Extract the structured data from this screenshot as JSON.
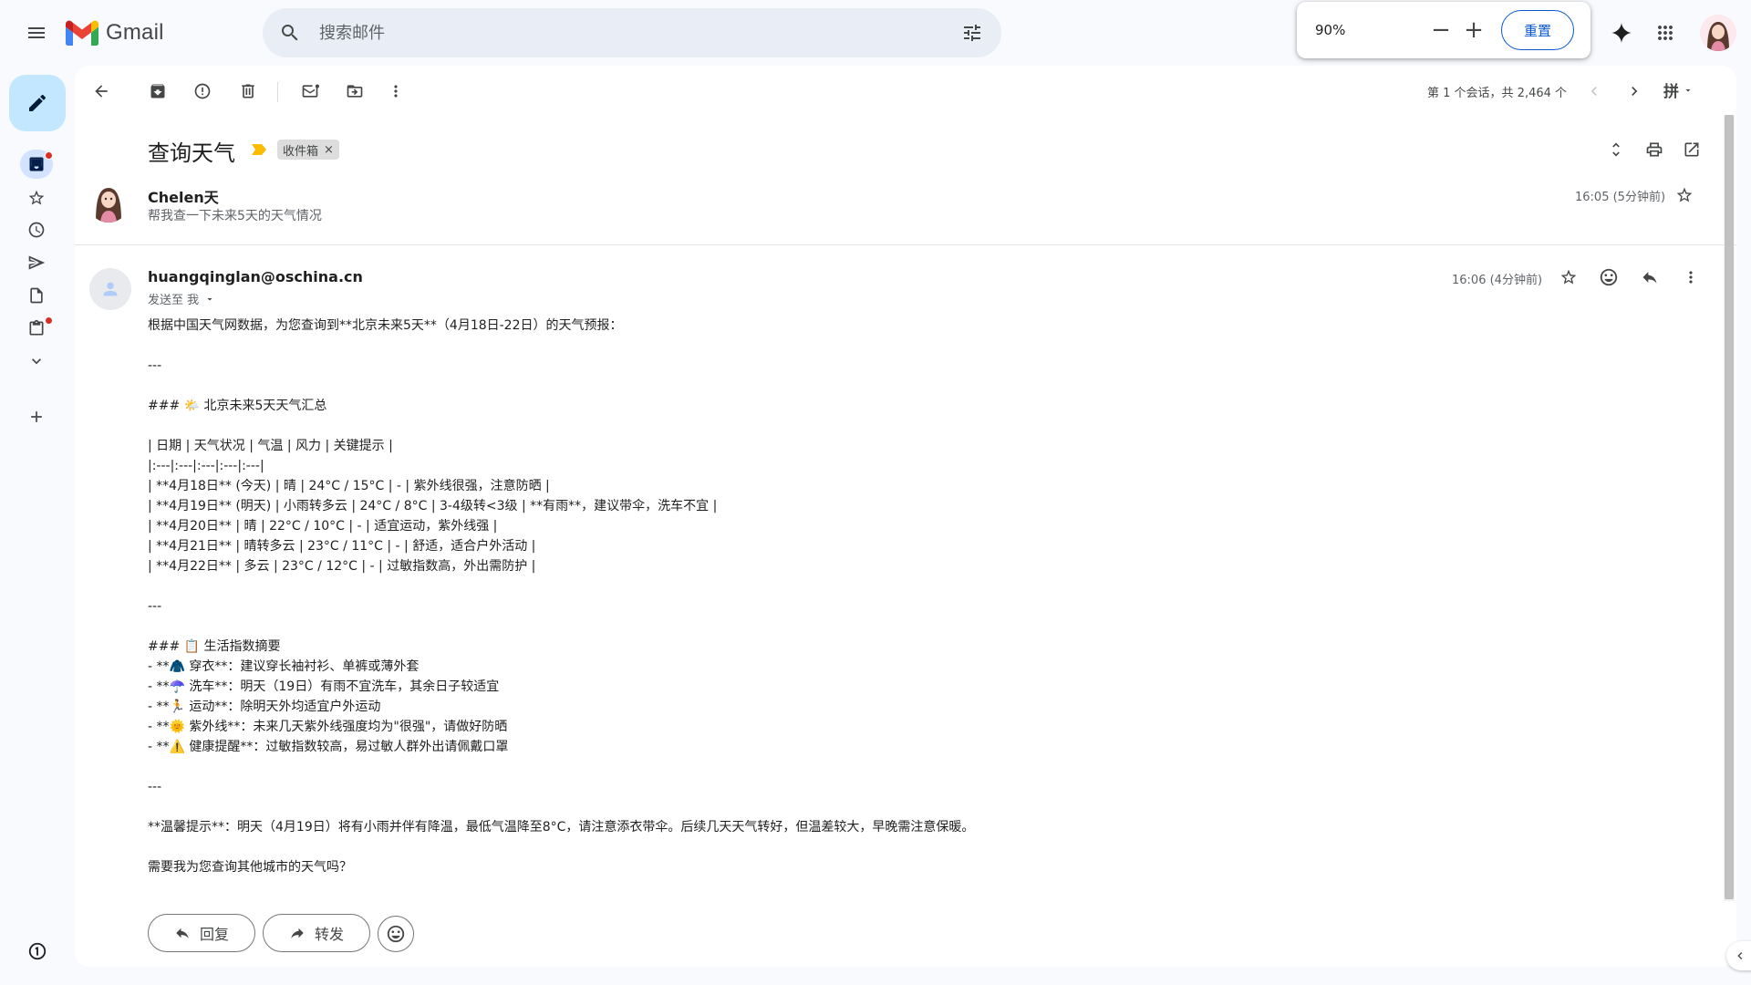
{
  "app": {
    "name": "Gmail"
  },
  "search": {
    "placeholder": "搜索邮件"
  },
  "zoom": {
    "value": "90%",
    "minus": "−",
    "plus": "+",
    "reset_label": "重置"
  },
  "toolbar": {
    "pager_text": "第 1 个会话，共 2,464 个",
    "input_method": "拼"
  },
  "thread": {
    "subject": "查询天气",
    "label": "收件箱",
    "label_remove": "×"
  },
  "message1": {
    "sender": "Chelen天",
    "snippet": "帮我查一下未来5天的天气情况",
    "time": "16:05 (5分钟前)"
  },
  "message2": {
    "sender": "huangqinglan@oschina.cn",
    "to": "发送至 我",
    "time": "16:06 (4分钟前)",
    "body": [
      "根据中国天气网数据，为您查询到**北京未来5天**（4月18日-22日）的天气预报：",
      "",
      "---",
      "",
      "### 🌤️ 北京未来5天天气汇总",
      "",
      "| 日期 | 天气状况 | 气温 | 风力 | 关键提示 |",
      "|:---|:---|:---|:---|:---|",
      "| **4月18日** (今天) | 晴 | 24°C / 15°C | - | 紫外线很强，注意防晒 |",
      "| **4月19日** (明天) | 小雨转多云 | 24°C / 8°C | 3-4级转<3级 | **有雨**，建议带伞，洗车不宜 |",
      "| **4月20日** | 晴 | 22°C / 10°C | - | 适宜运动，紫外线强 |",
      "| **4月21日** | 晴转多云 | 23°C / 11°C | - | 舒适，适合户外活动 |",
      "| **4月22日** | 多云 | 23°C / 12°C | - | 过敏指数高，外出需防护 |",
      "",
      "---",
      "",
      "### 📋 生活指数摘要",
      "- **🧥 穿衣**：建议穿长袖衬衫、单裤或薄外套",
      "- **☂️ 洗车**：明天（19日）有雨不宜洗车，其余日子较适宜",
      "- **🏃 运动**：除明天外均适宜户外运动",
      "- **🌞 紫外线**：未来几天紫外线强度均为\"很强\"，请做好防晒",
      "- **⚠️ 健康提醒**：过敏指数较高，易过敏人群外出请佩戴口罩",
      "",
      "---",
      "",
      "**温馨提示**：明天（4月19日）将有小雨并伴有降温，最低气温降至8°C，请注意添衣带伞。后续几天天气转好，但温差较大，早晚需注意保暖。",
      "",
      "需要我为您查询其他城市的天气吗？"
    ]
  },
  "actions": {
    "reply_label": "回复",
    "forward_label": "转发"
  },
  "colors": {
    "compose_bg": "#c2e7ff",
    "search_bg": "#e9eef6",
    "accent": "#0b57d0",
    "badge_red": "#d93025",
    "important_marker": "#fbbc04"
  },
  "icons": [
    "main-menu-icon",
    "search-icon",
    "search-options-icon",
    "gemini-icon",
    "apps-icon",
    "pencil-icon",
    "inbox-icon",
    "star-icon",
    "clock-icon",
    "send-icon",
    "draft-icon",
    "clipboard-icon",
    "chevron-down-icon",
    "plus-icon",
    "back-arrow-icon",
    "archive-icon",
    "report-spam-icon",
    "trash-icon",
    "mark-unread-icon",
    "move-to-icon",
    "more-vert-icon",
    "chevron-left-icon",
    "chevron-right-icon",
    "expand-all-icon",
    "print-icon",
    "open-new-window-icon",
    "emoji-icon",
    "reply-icon",
    "forward-icon"
  ]
}
